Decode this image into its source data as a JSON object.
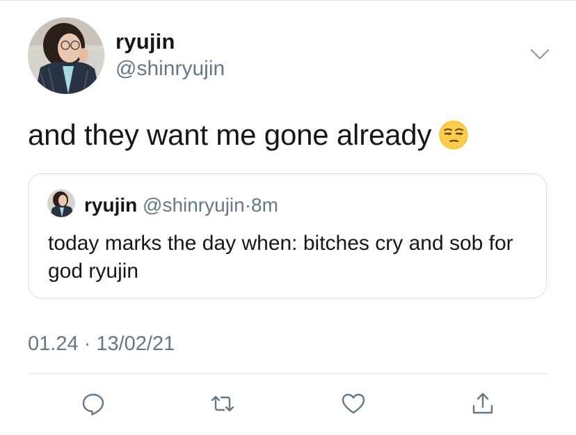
{
  "tweet": {
    "author": {
      "display_name": "ryujin",
      "handle": "@shinryujin"
    },
    "text": "and they want me gone already",
    "emoji": "unamused-face-emoji",
    "quoted": {
      "display_name": "ryujin",
      "handle": "@shinryujin",
      "separator": "·",
      "time": "8m",
      "text": "today marks the day when: bitches cry and sob for god ryujin"
    },
    "timestamp": "01.24 · 13/02/21"
  },
  "actions": [
    {
      "name": "reply",
      "icon": "reply-icon"
    },
    {
      "name": "retweet",
      "icon": "retweet-icon"
    },
    {
      "name": "like",
      "icon": "heart-icon"
    },
    {
      "name": "share",
      "icon": "share-icon"
    }
  ],
  "colors": {
    "primary_text": "#14171a",
    "secondary_text": "#657786",
    "divider": "#e1e8ed",
    "icon": "#657786"
  }
}
